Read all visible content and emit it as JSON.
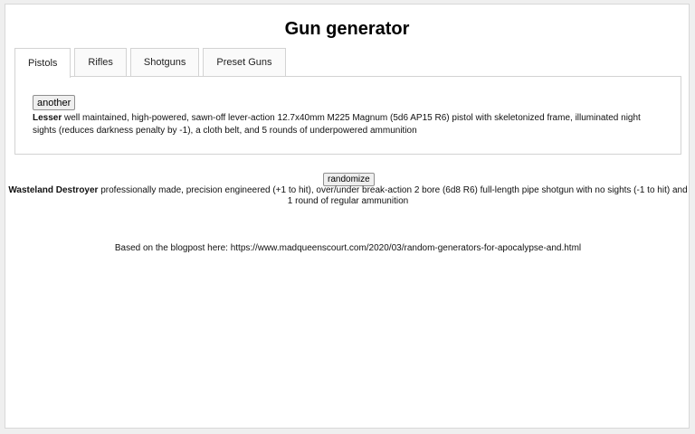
{
  "page": {
    "title": "Gun generator"
  },
  "tabs": [
    {
      "label": "Pistols",
      "active": true
    },
    {
      "label": "Rifles",
      "active": false
    },
    {
      "label": "Shotguns",
      "active": false
    },
    {
      "label": "Preset Guns",
      "active": false
    }
  ],
  "pistols": {
    "button_label": "another",
    "result_name": "Lesser",
    "result_text": " well maintained, high-powered, sawn-off lever-action 12.7x40mm M225 Magnum (5d6 AP15 R6) pistol with skeletonized frame, illuminated night sights (reduces darkness penalty by -1), a cloth belt, and 5 rounds of underpowered ammunition"
  },
  "shotguns": {
    "button_label": "randomize",
    "result_name": "Wasteland Destroyer",
    "result_text": " professionally made, precision engineered (+1 to hit), over/under break-action 2 bore (6d8 R6) full-length pipe shotgun with no sights (-1 to hit) and 1 round of regular ammunition"
  },
  "footer": {
    "note": "Based on the blogpost here: https://www.madqueenscourt.com/2020/03/random-generators-for-apocalypse-and.html"
  }
}
